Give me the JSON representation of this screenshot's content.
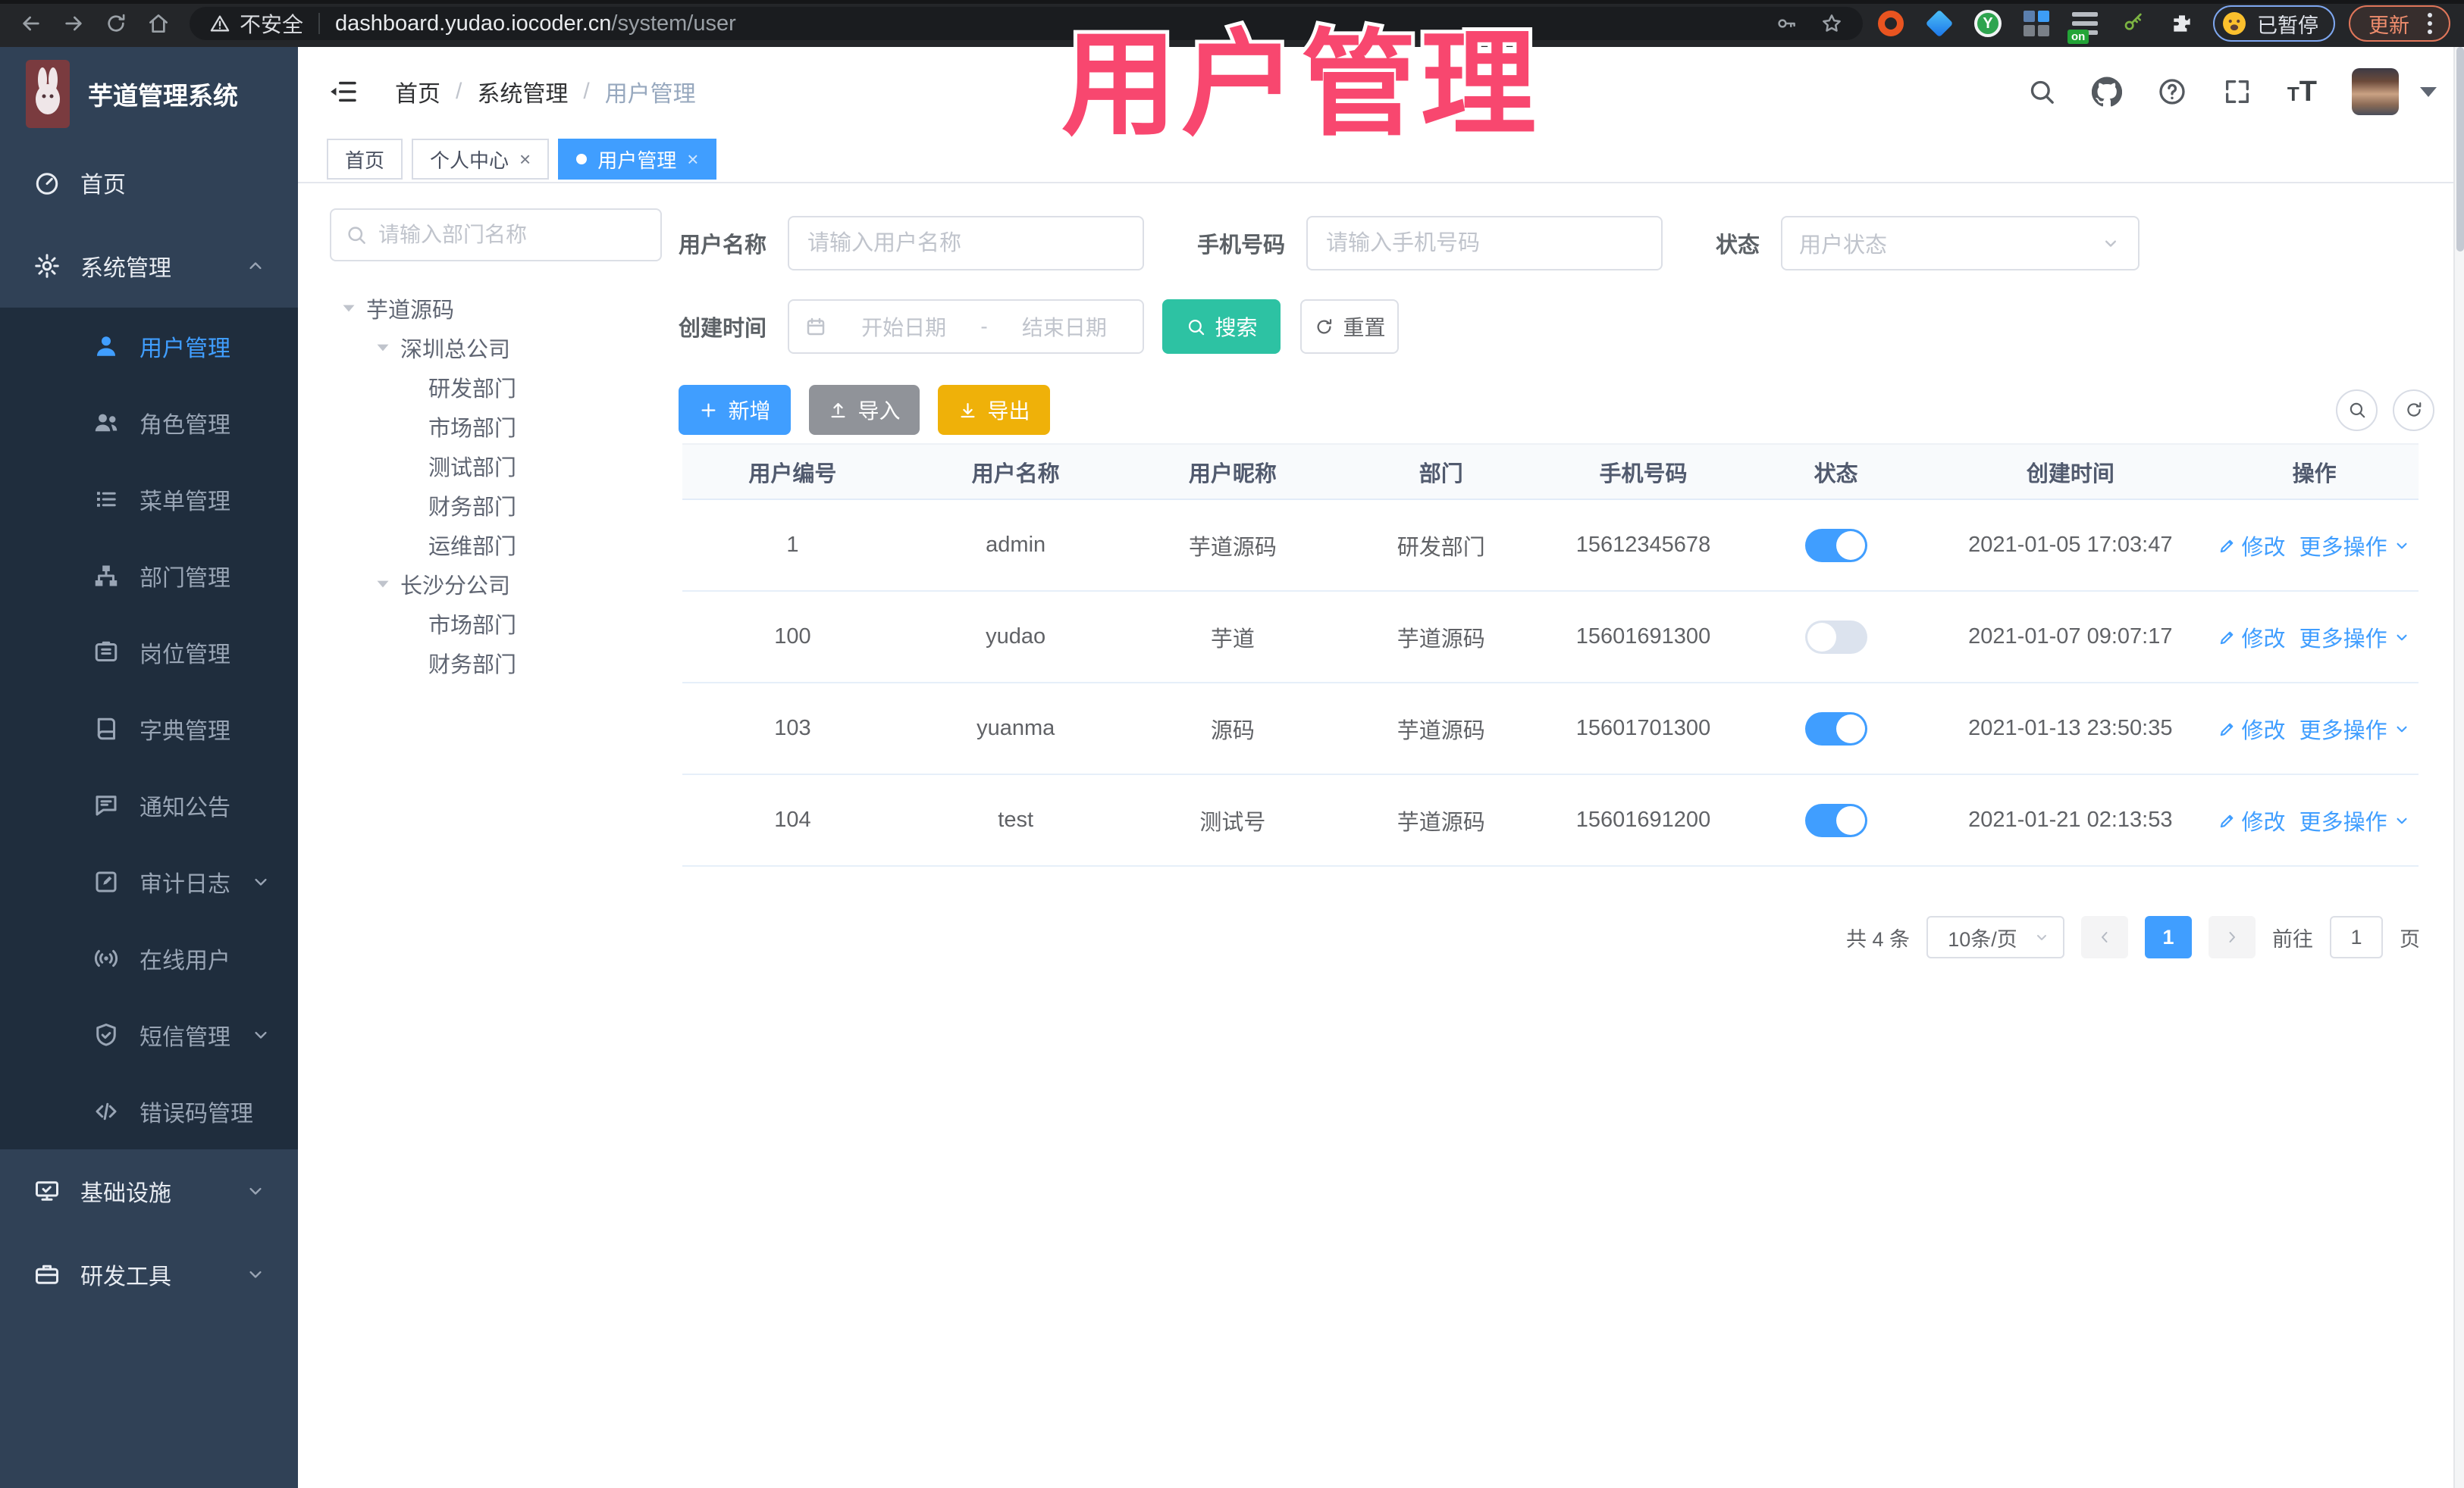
{
  "colors": {
    "primary": "#409EFF",
    "search-btn": "#2DC2A3",
    "export-btn": "#EFB109",
    "import-btn": "#909399",
    "sidebar-bg": "#304156",
    "submenu-bg": "#1F2D3D",
    "watermark": "#F8476F"
  },
  "watermark": {
    "text": "用户管理"
  },
  "browser": {
    "security_label": "不安全",
    "url_domain": "dashboard.yudao.iocoder.cn",
    "url_path": "/system/user",
    "paused_label": "已暂停",
    "update_label": "更新"
  },
  "app": {
    "title": "芋道管理系统"
  },
  "header": {
    "breadcrumb": [
      "首页",
      "系统管理",
      "用户管理"
    ],
    "separator": "/"
  },
  "tabs": [
    {
      "label": "首页",
      "closable": false,
      "active": false
    },
    {
      "label": "个人中心",
      "closable": true,
      "active": false
    },
    {
      "label": "用户管理",
      "closable": true,
      "active": true
    }
  ],
  "sidebar": {
    "items": [
      {
        "label": "首页",
        "icon": "dashboard",
        "level": 1
      },
      {
        "label": "系统管理",
        "icon": "gear",
        "level": 1,
        "chevron": "up"
      },
      {
        "label": "用户管理",
        "icon": "user",
        "level": 2,
        "active": true
      },
      {
        "label": "角色管理",
        "icon": "users",
        "level": 2
      },
      {
        "label": "菜单管理",
        "icon": "menu",
        "level": 2
      },
      {
        "label": "部门管理",
        "icon": "org-tree",
        "level": 2
      },
      {
        "label": "岗位管理",
        "icon": "id-badge",
        "level": 2
      },
      {
        "label": "字典管理",
        "icon": "dictionary",
        "level": 2
      },
      {
        "label": "通知公告",
        "icon": "announcement",
        "level": 2
      },
      {
        "label": "审计日志",
        "icon": "audit-log",
        "level": 2,
        "chevron": "down"
      },
      {
        "label": "在线用户",
        "icon": "online",
        "level": 2
      },
      {
        "label": "短信管理",
        "icon": "sms",
        "level": 2,
        "chevron": "down"
      },
      {
        "label": "错误码管理",
        "icon": "error-code",
        "level": 2
      },
      {
        "label": "基础设施",
        "icon": "infrastructure",
        "level": 1,
        "chevron": "down"
      },
      {
        "label": "研发工具",
        "icon": "devtools",
        "level": 1,
        "chevron": "down"
      }
    ]
  },
  "dept_panel": {
    "search_placeholder": "请输入部门名称",
    "tree": [
      {
        "label": "芋道源码",
        "level": 0,
        "expandable": true
      },
      {
        "label": "深圳总公司",
        "level": 1,
        "expandable": true
      },
      {
        "label": "研发部门",
        "level": 2,
        "expandable": false
      },
      {
        "label": "市场部门",
        "level": 2,
        "expandable": false
      },
      {
        "label": "测试部门",
        "level": 2,
        "expandable": false
      },
      {
        "label": "财务部门",
        "level": 2,
        "expandable": false
      },
      {
        "label": "运维部门",
        "level": 2,
        "expandable": false
      },
      {
        "label": "长沙分公司",
        "level": 1,
        "expandable": true
      },
      {
        "label": "市场部门",
        "level": 2,
        "expandable": false
      },
      {
        "label": "财务部门",
        "level": 2,
        "expandable": false
      }
    ]
  },
  "filters": {
    "username_label": "用户名称",
    "username_placeholder": "请输入用户名称",
    "mobile_label": "手机号码",
    "mobile_placeholder": "请输入手机号码",
    "status_label": "状态",
    "status_placeholder": "用户状态",
    "created_label": "创建时间",
    "date_start_placeholder": "开始日期",
    "date_separator": "-",
    "date_end_placeholder": "结束日期",
    "search_label": "搜索",
    "reset_label": "重置"
  },
  "toolbar": {
    "add_label": "新增",
    "import_label": "导入",
    "export_label": "导出"
  },
  "table": {
    "columns": [
      "用户编号",
      "用户名称",
      "用户昵称",
      "部门",
      "手机号码",
      "状态",
      "创建时间",
      "操作"
    ],
    "action_edit": "修改",
    "action_more": "更多操作",
    "rows": [
      {
        "id": "1",
        "username": "admin",
        "nickname": "芋道源码",
        "dept": "研发部门",
        "mobile": "15612345678",
        "status": "on",
        "created": "2021-01-05 17:03:47"
      },
      {
        "id": "100",
        "username": "yudao",
        "nickname": "芋道",
        "dept": "芋道源码",
        "mobile": "15601691300",
        "status": "off",
        "created": "2021-01-07 09:07:17"
      },
      {
        "id": "103",
        "username": "yuanma",
        "nickname": "源码",
        "dept": "芋道源码",
        "mobile": "15601701300",
        "status": "on",
        "created": "2021-01-13 23:50:35"
      },
      {
        "id": "104",
        "username": "test",
        "nickname": "测试号",
        "dept": "芋道源码",
        "mobile": "15601691200",
        "status": "on",
        "created": "2021-01-21 02:13:53"
      }
    ]
  },
  "pagination": {
    "total": "共 4 条",
    "page_size": "10条/页",
    "page": "1",
    "goto_label": "前往",
    "goto_value": "1",
    "unit_label": "页"
  }
}
